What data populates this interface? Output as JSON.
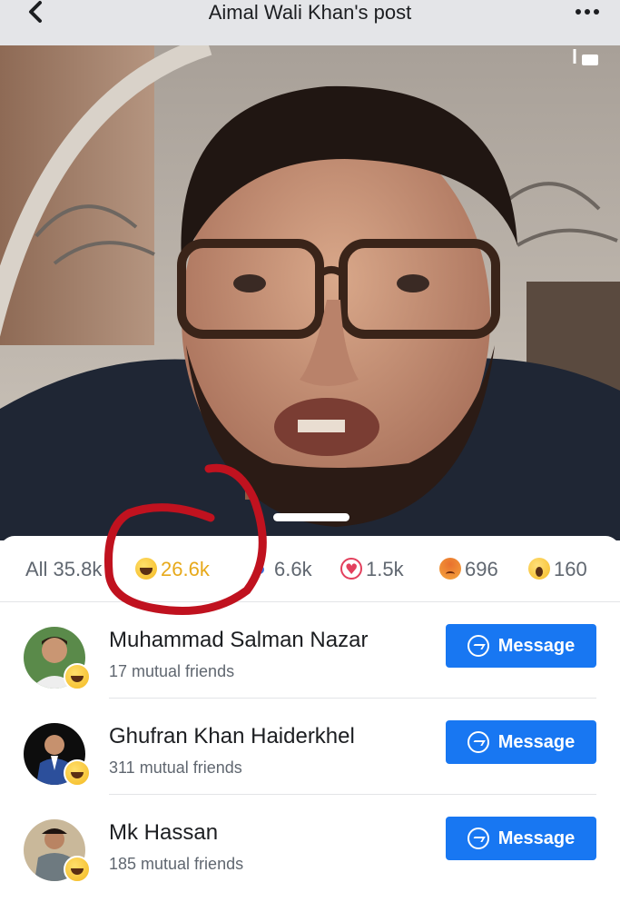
{
  "header": {
    "title": "Aimal Wali Khan's post",
    "back_icon": "chevron-left-icon",
    "more_icon": "more-dots-icon"
  },
  "video": {
    "fullscreen_icon": "fullscreen-icon"
  },
  "reactions": {
    "all": "All 35.8k",
    "haha": "26.6k",
    "like": "6.6k",
    "love": "1.5k",
    "angry": "696",
    "wow": "160",
    "active_color": "#e7a91a",
    "highlight_color": "#c0121f"
  },
  "people": [
    {
      "name": "Muhammad Salman Nazar",
      "mutual": "17 mutual friends",
      "button": "Message",
      "reaction_icon": "haha-icon"
    },
    {
      "name": "Ghufran Khan Haiderkhel",
      "mutual": "311 mutual friends",
      "button": "Message",
      "reaction_icon": "haha-icon"
    },
    {
      "name": "Mk Hassan",
      "mutual": "185 mutual friends",
      "button": "Message",
      "reaction_icon": "haha-icon"
    }
  ],
  "colors": {
    "brand": "#1877f2",
    "header_bg": "#e4e5e8"
  }
}
